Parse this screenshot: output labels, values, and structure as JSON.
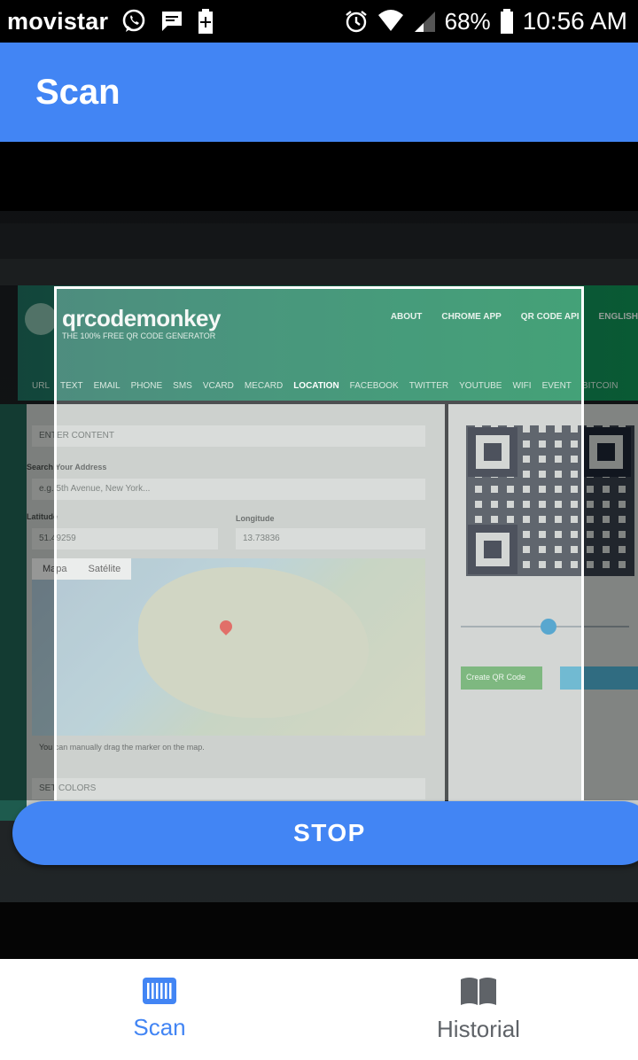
{
  "status_bar": {
    "carrier": "movistar",
    "battery_percent": "68%",
    "time": "10:56 AM",
    "icons": [
      "whatsapp-icon",
      "message-icon",
      "battery-saver-icon",
      "alarm-icon",
      "wifi-icon",
      "signal-icon",
      "battery-icon"
    ]
  },
  "app_bar": {
    "title": "Scan"
  },
  "camera_preview": {
    "site_logo": "qrcodemonkey",
    "site_subtitle": "THE 100% FREE QR CODE GENERATOR",
    "site_nav": [
      "ABOUT",
      "CHROME APP",
      "QR CODE API",
      "ENGLISH"
    ],
    "type_tabs": [
      "URL",
      "TEXT",
      "EMAIL",
      "PHONE",
      "SMS",
      "VCARD",
      "MECARD",
      "LOCATION",
      "FACEBOOK",
      "TWITTER",
      "YOUTUBE",
      "WIFI",
      "EVENT",
      "BITCOIN"
    ],
    "active_tab": "LOCATION",
    "enter_content": "ENTER CONTENT",
    "search_label": "Search Your Address",
    "search_placeholder": "e.g. 5th Avenue, New York...",
    "latitude_label": "Latitude",
    "latitude_value": "51.49259",
    "longitude_label": "Longitude",
    "longitude_value": "13.73836",
    "map_tabs": [
      "Mapa",
      "Satélite"
    ],
    "map_hint": "You can manually drag the marker on the map.",
    "set_colors": "SET COLORS",
    "create_button": "Create QR Code"
  },
  "stop_button": {
    "label": "STOP"
  },
  "bottom_nav": {
    "items": [
      {
        "label": "Scan",
        "icon": "barcode-scan-icon",
        "active": true
      },
      {
        "label": "Historial",
        "icon": "book-icon",
        "active": false
      }
    ]
  },
  "colors": {
    "primary": "#4285f4",
    "inactive": "#5f6368",
    "status_bar": "#000000"
  }
}
